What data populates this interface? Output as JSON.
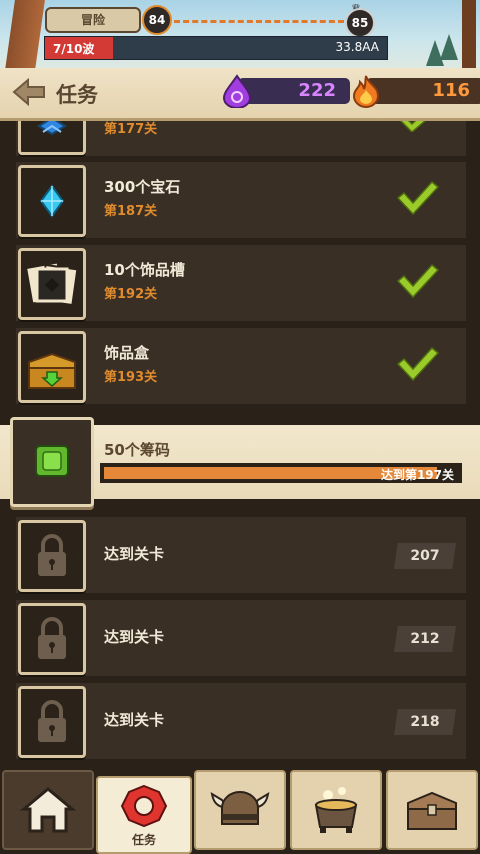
{
  "topbar": {
    "mode_label": "冒险",
    "current_level": "84",
    "next_level": "85",
    "wave_text": "7/10波",
    "wave_progress": 0.2,
    "damage_text": "33.8AA"
  },
  "header": {
    "title": "任务",
    "gems": "222",
    "flames": "116"
  },
  "quests": {
    "completed": [
      {
        "name": "",
        "stage": "第177关",
        "icon": "blue-book-icon"
      },
      {
        "name": "300个宝石",
        "stage": "第187关",
        "icon": "gem-icon"
      },
      {
        "name": "10个饰品槽",
        "stage": "第192关",
        "icon": "trinket-slots-icon"
      },
      {
        "name": "饰品盒",
        "stage": "第193关",
        "icon": "treasure-chest-icon"
      }
    ],
    "active": {
      "name": "50个筹码",
      "progress_text": "达到第197关",
      "progress": 0.94,
      "icon": "green-chip-icon"
    },
    "locked": [
      {
        "name": "达到关卡",
        "level": "207",
        "icon": "padlock-icon"
      },
      {
        "name": "达到关卡",
        "level": "212",
        "icon": "padlock-icon"
      },
      {
        "name": "达到关卡",
        "level": "218",
        "icon": "padlock-icon"
      }
    ]
  },
  "nav": {
    "tabs": [
      {
        "id": "home",
        "icon": "house-icon",
        "label": ""
      },
      {
        "id": "quests",
        "icon": "quest-badge-icon",
        "label": "任务"
      },
      {
        "id": "heroes",
        "icon": "viking-helmet-icon",
        "label": ""
      },
      {
        "id": "alchemy",
        "icon": "cauldron-icon",
        "label": ""
      },
      {
        "id": "chest",
        "icon": "chest-icon",
        "label": ""
      }
    ]
  },
  "colors": {
    "accent_orange": "#e08b2e",
    "check_green": "#9acb2a",
    "gem_purple": "#d985ff",
    "wave_red": "#d43a35"
  }
}
